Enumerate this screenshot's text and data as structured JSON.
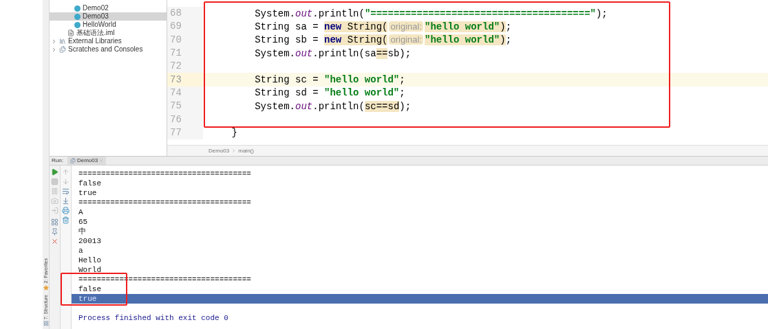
{
  "project_tree": {
    "items": [
      {
        "label": "Demo02",
        "kind": "class",
        "selected": false
      },
      {
        "label": "Demo03",
        "kind": "class",
        "selected": true
      },
      {
        "label": "HelloWorld",
        "kind": "class",
        "selected": false
      },
      {
        "label": "基础语法.iml",
        "kind": "module-file",
        "selected": false
      },
      {
        "label": "External Libraries",
        "kind": "library",
        "selected": false,
        "expanded": false
      },
      {
        "label": "Scratches and Consoles",
        "kind": "scratches",
        "selected": false,
        "expanded": false
      }
    ]
  },
  "editor": {
    "lines": [
      {
        "number": "68",
        "current": false,
        "tokens": [
          {
            "kind": "plain",
            "text": "        System.",
            "marked": false
          },
          {
            "kind": "field",
            "text": "out",
            "marked": false
          },
          {
            "kind": "plain",
            "text": ".println(",
            "marked": false
          },
          {
            "kind": "string",
            "text": "\"======================================\"",
            "marked": false
          },
          {
            "kind": "plain",
            "text": ");",
            "marked": false
          }
        ]
      },
      {
        "number": "69",
        "current": false,
        "tokens": [
          {
            "kind": "plain",
            "text": "        String sa = ",
            "marked": false
          },
          {
            "kind": "keyword",
            "text": "new",
            "marked": true
          },
          {
            "kind": "plain",
            "text": " String(",
            "marked": true
          },
          {
            "kind": "hint",
            "text": "original:",
            "marked": true
          },
          {
            "kind": "string",
            "text": "\"hello world\"",
            "marked": true
          },
          {
            "kind": "plain",
            "text": ")",
            "marked": true
          },
          {
            "kind": "plain",
            "text": ";",
            "marked": false
          }
        ]
      },
      {
        "number": "70",
        "current": false,
        "tokens": [
          {
            "kind": "plain",
            "text": "        String sb = ",
            "marked": false
          },
          {
            "kind": "keyword",
            "text": "new",
            "marked": true
          },
          {
            "kind": "plain",
            "text": " String(",
            "marked": true
          },
          {
            "kind": "hint",
            "text": "original:",
            "marked": true
          },
          {
            "kind": "string",
            "text": "\"hello world\"",
            "marked": true
          },
          {
            "kind": "plain",
            "text": ")",
            "marked": true
          },
          {
            "kind": "plain",
            "text": ";",
            "marked": false
          }
        ]
      },
      {
        "number": "71",
        "current": false,
        "tokens": [
          {
            "kind": "plain",
            "text": "        System.",
            "marked": false
          },
          {
            "kind": "field",
            "text": "out",
            "marked": false
          },
          {
            "kind": "plain",
            "text": ".println(sa",
            "marked": false
          },
          {
            "kind": "plain",
            "text": "==",
            "marked": true
          },
          {
            "kind": "plain",
            "text": "sb);",
            "marked": false
          }
        ]
      },
      {
        "number": "72",
        "current": false
      },
      {
        "number": "73",
        "current": true,
        "tokens": [
          {
            "kind": "plain",
            "text": "        String sc = ",
            "marked": false
          },
          {
            "kind": "string",
            "text": "\"hello world\"",
            "marked": false
          },
          {
            "kind": "plain",
            "text": ";",
            "marked": false
          }
        ]
      },
      {
        "number": "74",
        "current": false,
        "tokens": [
          {
            "kind": "plain",
            "text": "        String sd = ",
            "marked": false
          },
          {
            "kind": "string",
            "text": "\"hello world\"",
            "marked": false
          },
          {
            "kind": "plain",
            "text": ";",
            "marked": false
          }
        ]
      },
      {
        "number": "75",
        "current": false,
        "tokens": [
          {
            "kind": "plain",
            "text": "        System.",
            "marked": false
          },
          {
            "kind": "field",
            "text": "out",
            "marked": false
          },
          {
            "kind": "plain",
            "text": ".println(",
            "marked": false
          },
          {
            "kind": "plain",
            "text": "sc==sd",
            "marked": true
          },
          {
            "kind": "plain",
            "text": ");",
            "marked": false
          }
        ]
      },
      {
        "number": "76",
        "current": false
      },
      {
        "number": "77",
        "current": false,
        "tokens": [
          {
            "kind": "plain",
            "text": "    }",
            "marked": false
          }
        ]
      }
    ]
  },
  "breadcrumbs": [
    "Demo03",
    "main()"
  ],
  "side_labels": [
    "2: Favorites",
    "7: Structure"
  ],
  "run_panel": {
    "label": "Run:",
    "tabs": [
      {
        "label": "Demo03",
        "selected": true
      }
    ],
    "output": [
      {
        "kind": "stdout",
        "text": "======================================",
        "selected": false
      },
      {
        "kind": "stdout",
        "text": "false",
        "selected": false
      },
      {
        "kind": "stdout",
        "text": "true",
        "selected": false
      },
      {
        "kind": "stdout",
        "text": "======================================",
        "selected": false
      },
      {
        "kind": "stdout",
        "text": "A",
        "selected": false
      },
      {
        "kind": "stdout",
        "text": "65",
        "selected": false
      },
      {
        "kind": "stdout",
        "text": "中",
        "selected": false
      },
      {
        "kind": "stdout",
        "text": "20013",
        "selected": false
      },
      {
        "kind": "stdout",
        "text": "a",
        "selected": false
      },
      {
        "kind": "stdout",
        "text": "Hello",
        "selected": false
      },
      {
        "kind": "stdout",
        "text": "World",
        "selected": false
      },
      {
        "kind": "stdout",
        "text": "======================================",
        "selected": false
      },
      {
        "kind": "stdout",
        "text": "false",
        "selected": false
      },
      {
        "kind": "stdout",
        "text": "true",
        "selected": true
      },
      {
        "kind": "exit",
        "text": "Process finished with exit code 0",
        "selected": false
      }
    ]
  }
}
